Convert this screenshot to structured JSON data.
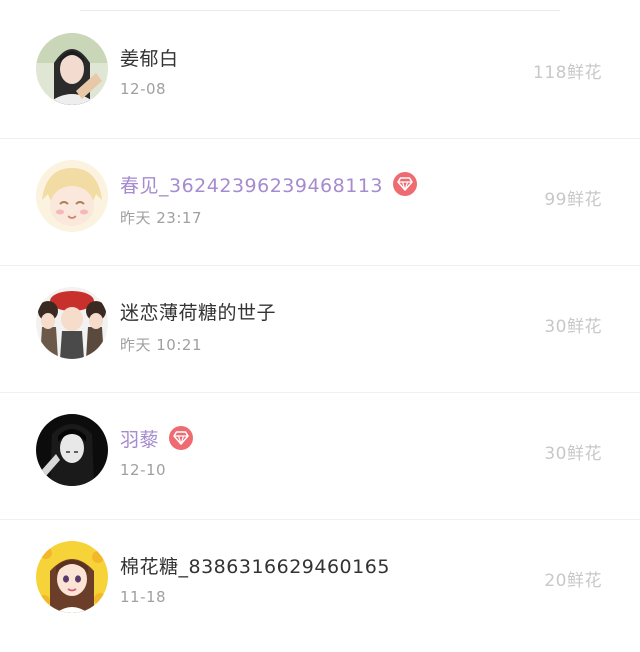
{
  "items": [
    {
      "name": "姜郁白",
      "time": "12-08",
      "flowers": "118鲜花",
      "vip": false
    },
    {
      "name": "春见_36242396239468113",
      "time": "昨天 23:17",
      "flowers": "99鲜花",
      "vip": true
    },
    {
      "name": "迷恋薄荷糖的世子",
      "time": "昨天 10:21",
      "flowers": "30鲜花",
      "vip": false
    },
    {
      "name": "羽藜",
      "time": "12-10",
      "flowers": "30鲜花",
      "vip": true
    },
    {
      "name": "棉花糖_8386316629460165",
      "time": "11-18",
      "flowers": "20鲜花",
      "vip": false
    }
  ],
  "colors": {
    "vip_name": "#a58bcf",
    "vip_badge": "#ef6b72",
    "name": "#333333",
    "time": "#a0a0a0",
    "flowers": "#c8c8c8"
  },
  "icons": {
    "vip_badge": "diamond-icon"
  }
}
